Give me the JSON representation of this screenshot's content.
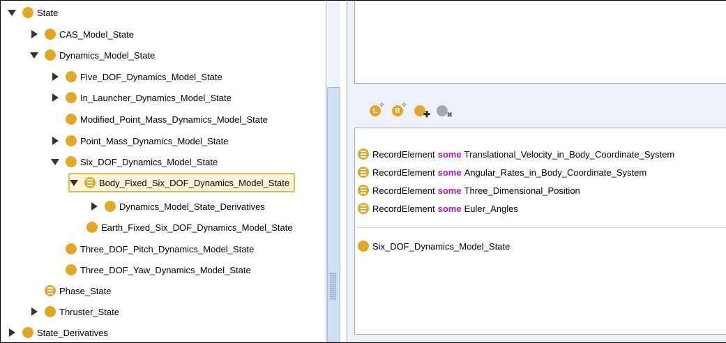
{
  "tree": {
    "nodes": [
      {
        "label": "State",
        "toggle": "open",
        "icon": "class"
      },
      {
        "label": "CAS_Model_State",
        "toggle": "closed",
        "icon": "class"
      },
      {
        "label": "Dynamics_Model_State",
        "toggle": "open",
        "icon": "class"
      },
      {
        "label": "Five_DOF_Dynamics_Model_State",
        "toggle": "closed",
        "icon": "class"
      },
      {
        "label": "In_Launcher_Dynamics_Model_State",
        "toggle": "closed",
        "icon": "class"
      },
      {
        "label": "Modified_Point_Mass_Dynamics_Model_State",
        "toggle": "none",
        "icon": "class"
      },
      {
        "label": "Point_Mass_Dynamics_Model_State",
        "toggle": "closed",
        "icon": "class"
      },
      {
        "label": "Six_DOF_Dynamics_Model_State",
        "toggle": "open",
        "icon": "class"
      },
      {
        "label": "Body_Fixed_Six_DOF_Dynamics_Model_State",
        "toggle": "open",
        "icon": "defined-class",
        "selected": true
      },
      {
        "label": "Dynamics_Model_State_Derivatives",
        "toggle": "closed",
        "icon": "class"
      },
      {
        "label": "Earth_Fixed_Six_DOF_Dynamics_Model_State",
        "toggle": "none",
        "icon": "class"
      },
      {
        "label": "Three_DOF_Pitch_Dynamics_Model_State",
        "toggle": "none",
        "icon": "class"
      },
      {
        "label": "Three_DOF_Yaw_Dynamics_Model_State",
        "toggle": "none",
        "icon": "class"
      },
      {
        "label": "Phase_State",
        "toggle": "none",
        "icon": "defined-class"
      },
      {
        "label": "Thruster_State",
        "toggle": "closed",
        "icon": "class"
      },
      {
        "label": "State_Derivatives",
        "toggle": "closed",
        "icon": "class"
      }
    ]
  },
  "toolbar": {
    "buttons": [
      {
        "icon": "add-label-icon",
        "glyph": "L"
      },
      {
        "icon": "add-restriction-icon",
        "glyph": "R"
      },
      {
        "icon": "add-class-icon",
        "glyph": ""
      },
      {
        "icon": "remove-class-icon",
        "glyph": ""
      }
    ]
  },
  "restrictions": {
    "items": [
      {
        "property": "RecordElement",
        "keyword": "some",
        "filler": "Translational_Velocity_in_Body_Coordinate_System"
      },
      {
        "property": "RecordElement",
        "keyword": "some",
        "filler": "Angular_Rates_in_Body_Coordinate_System"
      },
      {
        "property": "RecordElement",
        "keyword": "some",
        "filler": "Three_Dimensional_Position"
      },
      {
        "property": "RecordElement",
        "keyword": "some",
        "filler": "Euler_Angles"
      }
    ],
    "superclass": "Six_DOF_Dynamics_Model_State"
  },
  "colors": {
    "class_icon": "#e2a824",
    "keyword": "#b515c1",
    "selection_border": "#f2b450"
  }
}
